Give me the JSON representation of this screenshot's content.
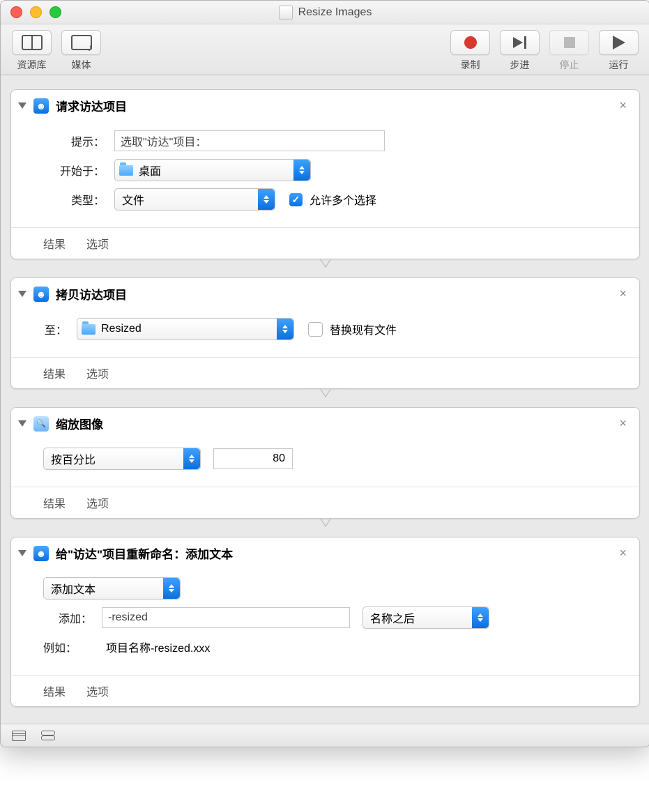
{
  "window": {
    "title": "Resize Images"
  },
  "toolbar": {
    "library": "资源库",
    "media": "媒体",
    "record": "录制",
    "step": "步进",
    "stop": "停止",
    "run": "运行"
  },
  "actions": {
    "a1": {
      "title": "请求访达项目",
      "promptLabel": "提示：",
      "promptValue": "选取\"访达\"项目：",
      "startLabel": "开始于：",
      "startValue": "桌面",
      "typeLabel": "类型：",
      "typeValue": "文件",
      "allowMultiple": "允许多个选择",
      "allowMultipleChecked": true,
      "results": "结果",
      "options": "选项"
    },
    "a2": {
      "title": "拷贝访达项目",
      "toLabel": "至：",
      "toValue": "Resized",
      "replace": "替换现有文件",
      "replaceChecked": false,
      "results": "结果",
      "options": "选项"
    },
    "a3": {
      "title": "缩放图像",
      "mode": "按百分比",
      "value": "80",
      "results": "结果",
      "options": "选项"
    },
    "a4": {
      "title": "给\"访达\"项目重新命名：添加文本",
      "mode": "添加文本",
      "addLabel": "添加：",
      "addValue": "-resized",
      "position": "名称之后",
      "exampleLabel": "例如：",
      "exampleValue": "项目名称-resized.xxx",
      "results": "结果",
      "options": "选项"
    }
  }
}
